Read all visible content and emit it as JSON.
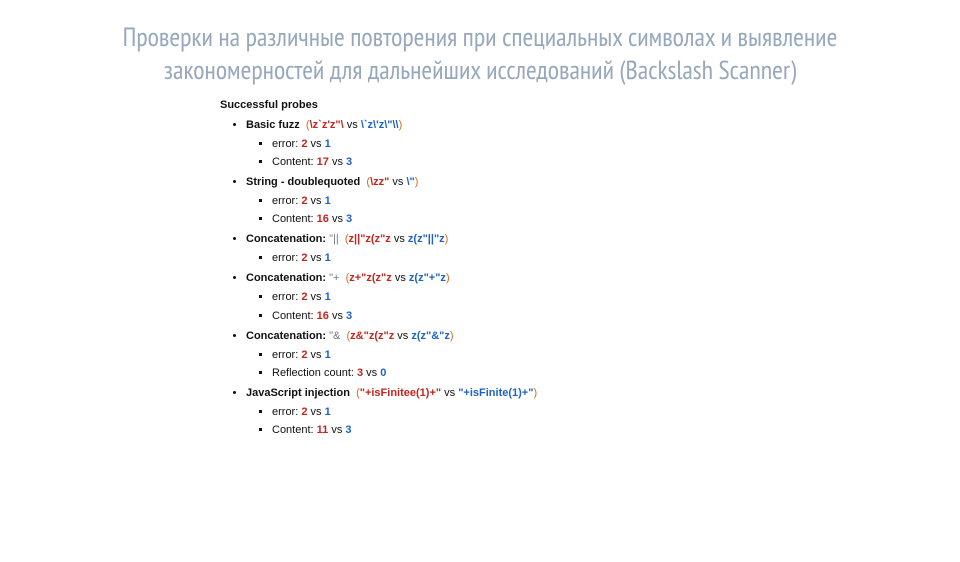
{
  "title": "Проверки на различные повторения при специальных символах и выявление закономерностей для дальнейших исследований (Backslash Scanner)",
  "section_header": "Successful probes",
  "probes": [
    {
      "label_bold": "Basic fuzz",
      "label_gray": "",
      "paren_open": "(",
      "a": "\\z`z'z\"\\",
      "vs": " vs ",
      "b": "\\`z\\'z\\\"\\\\",
      "paren_close": ")",
      "details": [
        {
          "k": "error:",
          "a": "2",
          "sep": " vs ",
          "b": "1"
        },
        {
          "k": "Content:",
          "a": "17",
          "sep": " vs ",
          "b": "3"
        }
      ]
    },
    {
      "label_bold": "String - doublequoted",
      "label_gray": "",
      "paren_open": "(",
      "a": "\\zz\"",
      "vs": " vs ",
      "b": "\\\"",
      "paren_close": ")",
      "details": [
        {
          "k": "error:",
          "a": "2",
          "sep": " vs ",
          "b": "1"
        },
        {
          "k": "Content:",
          "a": "16",
          "sep": " vs ",
          "b": "3"
        }
      ]
    },
    {
      "label_bold": "Concatenation:",
      "label_gray": " \"||",
      "paren_open": "(",
      "a": "z||\"z(z\"z",
      "vs": " vs ",
      "b": "z(z\"||\"z",
      "paren_close": ")",
      "details": [
        {
          "k": "error:",
          "a": "2",
          "sep": " vs ",
          "b": "1"
        }
      ]
    },
    {
      "label_bold": "Concatenation:",
      "label_gray": " \"+",
      "paren_open": "(",
      "a": "z+\"z(z\"z",
      "vs": " vs ",
      "b": "z(z\"+\"z",
      "paren_close": ")",
      "details": [
        {
          "k": "error:",
          "a": "2",
          "sep": " vs ",
          "b": "1"
        },
        {
          "k": "Content:",
          "a": "16",
          "sep": " vs ",
          "b": "3"
        }
      ]
    },
    {
      "label_bold": "Concatenation:",
      "label_gray": " \"&",
      "paren_open": "(",
      "a": "z&\"z(z\"z",
      "vs": " vs ",
      "b": "z(z\"&\"z",
      "paren_close": ")",
      "details": [
        {
          "k": "error:",
          "a": "2",
          "sep": " vs ",
          "b": "1"
        },
        {
          "k": "Reflection count:",
          "a": "3",
          "sep": " vs ",
          "b": "0"
        }
      ]
    },
    {
      "label_bold": "JavaScript injection",
      "label_gray": "",
      "paren_open": "(",
      "a": "\"+isFinitee(1)+\"",
      "vs": " vs ",
      "b": "\"+isFinite(1)+\"",
      "paren_close": ")",
      "details": [
        {
          "k": "error:",
          "a": "2",
          "sep": " vs ",
          "b": "1"
        },
        {
          "k": "Content:",
          "a": "11",
          "sep": " vs ",
          "b": "3"
        }
      ]
    }
  ]
}
